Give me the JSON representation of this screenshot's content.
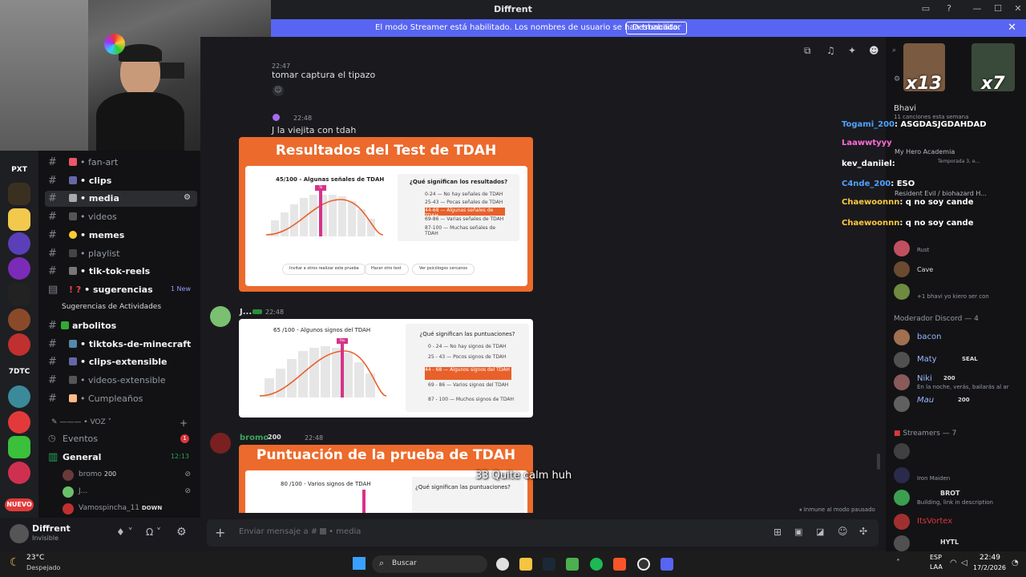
{
  "window": {
    "title": "Diffrent"
  },
  "streamer_banner": {
    "message": "El modo Streamer está habilitado. Los nombres de usuario se han truncado.",
    "button": "Deshabilitar"
  },
  "servers": [
    "PXT",
    "7DTC",
    "NUEVO"
  ],
  "channels": [
    {
      "name": "fan-art",
      "bold": false
    },
    {
      "name": "clips",
      "bold": true
    },
    {
      "name": "media",
      "bold": true,
      "active": true
    },
    {
      "name": "videos",
      "bold": false
    },
    {
      "name": "memes",
      "bold": true
    },
    {
      "name": "playlist",
      "bold": false
    },
    {
      "name": "tik-tok-reels",
      "bold": true
    },
    {
      "name": "sugerencias",
      "bold": true,
      "badge": "1 New"
    },
    {
      "name": "Sugerencias de Actividades",
      "bold": false,
      "thread": true
    },
    {
      "name": "arbolitos",
      "bold": true
    },
    {
      "name": "tiktoks-de-minecraft",
      "bold": true
    },
    {
      "name": "clips-extensible",
      "bold": true
    },
    {
      "name": "videos-extensible",
      "bold": false
    },
    {
      "name": "Cumpleaños",
      "bold": false
    }
  ],
  "voice": {
    "category": "VOZ",
    "events": "Eventos",
    "events_count": "1",
    "general": "General",
    "general_time": "12:13",
    "members": [
      {
        "name": "bromo",
        "tag": "200"
      },
      {
        "name": "J..."
      },
      {
        "name": "Vamospincha_11",
        "tag": "DOWN"
      }
    ]
  },
  "user_panel": {
    "name": "Diffrent",
    "status": "Invisible"
  },
  "messages": [
    {
      "time": "22:47",
      "text": "tomar captura el tipazo"
    },
    {
      "time": "22:48",
      "text": "J la viejita con tdah"
    },
    {
      "author": "J...",
      "time": "22:48"
    },
    {
      "author": "bromo",
      "tag": "200",
      "time": "22:48"
    }
  ],
  "image1": {
    "title": "Resultados del Test de TDAH",
    "score": "45/100 - Algunas señales de TDAH",
    "legend_title": "¿Qué significan los resultados?",
    "legend": [
      "0-24  —  No hay señales de TDAH",
      "25-43  —  Pocas señales de TDAH",
      "44-68  —  Algunas señales de TDAH",
      "69-86  —  Varias señales de TDAH",
      "87-100  —  Muchas señales de TDAH"
    ],
    "buttons": [
      "Invitar a otros realizar este prueba",
      "Hacer otro test",
      "Ver psicólogos cercanos"
    ],
    "marker": "Tú"
  },
  "image2": {
    "score": "65 /100 - Algunos signos del TDAH",
    "legend_title": "¿Qué significan las puntuaciones?",
    "legend": [
      "0 - 24  —  No hay signos de TDAH",
      "25 - 43  —  Pocos signos de TDAH",
      "44 - 68  —  Algunos signos del TDAH",
      "69 - 86  —  Varios signos del TDAH",
      "87 - 100  —  Muchos signos de TDAH"
    ],
    "marker": "You"
  },
  "image3": {
    "title": "Puntuación de la prueba de TDAH",
    "score": "80 /100 - Varios signos de TDAH",
    "legend_title": "¿Qué significan las puntuaciones?"
  },
  "caption": "33 Quite calm huh",
  "composer": {
    "placeholder": "Enviar mensaje a #",
    "channel": "media"
  },
  "paused": "Inmune al modo pausado",
  "overlay_chat": [
    {
      "user": "Togami_200",
      "text": ": ASGDASJGDAHDAD",
      "color": "#4fa3ff"
    },
    {
      "user": "Laawwtyyy",
      "text": "",
      "color": "#ff6bd6"
    },
    {
      "user": "kev_daniiel",
      "text": ":",
      "color": "#ffffff"
    },
    {
      "user": "C4nde_200",
      "text": ": ESO",
      "color": "#4fa3ff"
    },
    {
      "user": "Chaewoonnn",
      "text": ": q no soy cande",
      "color": "#ffc83d"
    },
    {
      "user": "Chaewoonnn",
      "text": ": q no soy cande",
      "color": "#ffc83d"
    }
  ],
  "overlay_counters": [
    "x13",
    "x7"
  ],
  "members": {
    "activity": {
      "name": "Bhavi",
      "sub": "11 canciones esta semana"
    },
    "activity_items": [
      "My Hero Academia",
      "Temporada 3, e...",
      "Resident Evil / biohazard H..."
    ],
    "others": [
      {
        "sub": "Rust"
      },
      {
        "sub": "Cave"
      },
      {
        "sub": "+1 bhavi yo kiero ser con"
      }
    ],
    "mod_category": "Moderador Discord — 4",
    "mods": [
      {
        "name": "bacon"
      },
      {
        "name": "Maty",
        "tag": "SEAL"
      },
      {
        "name": "Niki",
        "tag": "200",
        "sub": "En la noche, verás, bailarás al ar"
      },
      {
        "name": "Mau",
        "tag": "200"
      }
    ],
    "streamer_category": "Streamers — 7",
    "streamers": [
      {
        "name": "",
        "sub": "Iron Maiden"
      },
      {
        "name": "BROT",
        "sub": "Building, link in description"
      },
      {
        "name": "ItsVortex"
      },
      {
        "name": "HYTL"
      }
    ]
  },
  "taskbar": {
    "weather_temp": "23°C",
    "weather_desc": "Despejado",
    "search": "Buscar",
    "lang1": "ESP",
    "lang2": "LAA",
    "time": "22:49",
    "date": "17/2/2026"
  }
}
